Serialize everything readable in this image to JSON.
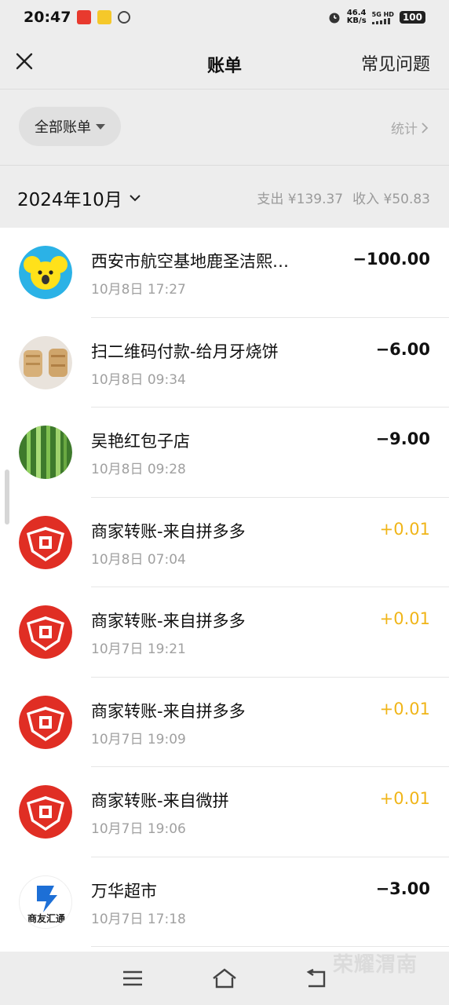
{
  "status_bar": {
    "time": "20:47",
    "net_speed_value": "46.4",
    "net_speed_unit": "KB/s",
    "network": "5G HD",
    "battery": "100"
  },
  "header": {
    "title": "账单",
    "faq_label": "常见问题"
  },
  "filter": {
    "label": "全部账单",
    "stats_label": "统计"
  },
  "month": {
    "label": "2024年10月",
    "expense": "支出 ¥139.37",
    "income": "收入 ¥50.83"
  },
  "transactions": [
    {
      "name": "西安市航空基地鹿圣洁熙…",
      "date": "10月8日 17:27",
      "amount": "−100.00",
      "avatar": "koala-avatar"
    },
    {
      "name": "扫二维码付款-给月牙烧饼",
      "date": "10月8日 09:34",
      "amount": "−6.00",
      "avatar": "flatbread-avatar"
    },
    {
      "name": "吴艳红包子店",
      "date": "10月8日 09:28",
      "amount": "−9.00",
      "avatar": "bamboo-avatar"
    },
    {
      "name": "商家转账-来自拼多多",
      "date": "10月8日 07:04",
      "amount": "+0.01",
      "avatar": "pinduoduo-avatar"
    },
    {
      "name": "商家转账-来自拼多多",
      "date": "10月7日 19:21",
      "amount": "+0.01",
      "avatar": "pinduoduo-avatar"
    },
    {
      "name": "商家转账-来自拼多多",
      "date": "10月7日 19:09",
      "amount": "+0.01",
      "avatar": "pinduoduo-avatar"
    },
    {
      "name": "商家转账-来自微拼",
      "date": "10月7日 19:06",
      "amount": "+0.01",
      "avatar": "pinduoduo-avatar"
    },
    {
      "name": "万华超市",
      "date": "10月7日 17:18",
      "amount": "−3.00",
      "avatar": "shangyou-logo-avatar",
      "logo_text": "商友汇通"
    }
  ],
  "colors": {
    "income": "#f0b518",
    "pinduoduo_red": "#e02e24"
  },
  "watermark": "荣耀渭南"
}
